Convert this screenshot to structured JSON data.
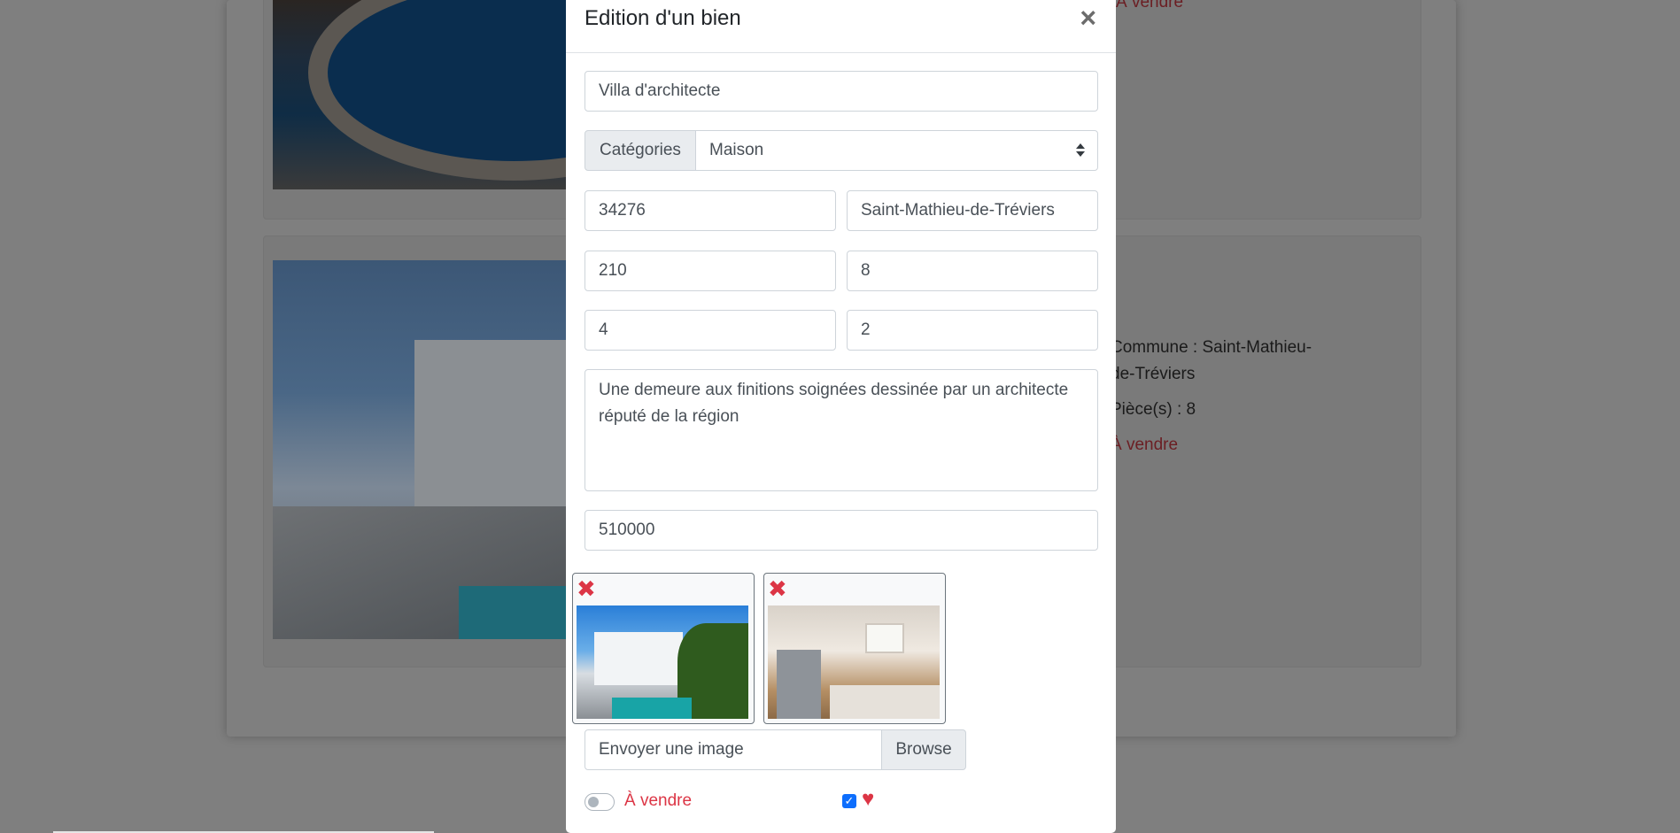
{
  "background": {
    "card2": {
      "commune_line1": "Commune : Saint-Mathieu-",
      "commune_line2": "de-Tréviers",
      "pieces": "Pièce(s) : 8",
      "status": "À vendre"
    },
    "card1": {
      "status": "À vendre"
    }
  },
  "modal": {
    "title": "Edition d'un bien",
    "close_symbol": "×",
    "fields": {
      "name": "Villa d'architecte",
      "category_label": "Catégories",
      "category_value": "Maison",
      "postal_code": "34276",
      "city": "Saint-Mathieu-de-Tréviers",
      "surface": "210",
      "rooms": "8",
      "bedrooms": "4",
      "bathrooms": "2",
      "description": "Une demeure aux finitions soignées dessinée par un architecte réputé de la région",
      "price": "510000"
    },
    "images": [
      {
        "icon": "delete-icon",
        "delete_symbol": "✖",
        "alt": "exterior photo"
      },
      {
        "icon": "delete-icon",
        "delete_symbol": "✖",
        "alt": "kitchen photo"
      }
    ],
    "upload": {
      "placeholder": "Envoyer une image",
      "browse_label": "Browse"
    },
    "toggle_label": "À vendre",
    "checkbox_mark": "✓",
    "heart_symbol": "♥",
    "colors": {
      "danger": "#dc3545",
      "primary": "#0d6efd",
      "border": "#ced4da"
    }
  }
}
